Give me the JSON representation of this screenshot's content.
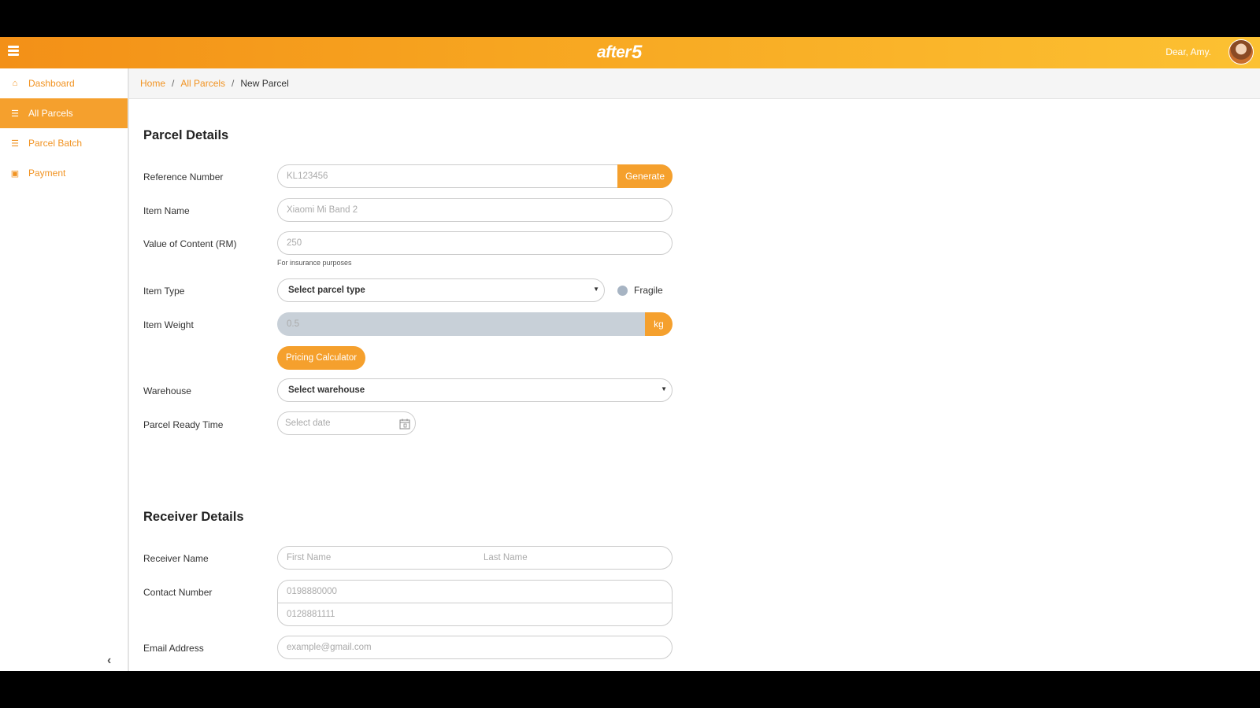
{
  "header": {
    "logo_text": "after",
    "logo_number": "5",
    "greeting": "Dear, Amy."
  },
  "sidebar": {
    "items": [
      {
        "label": "Dashboard",
        "icon": "home-icon"
      },
      {
        "label": "All Parcels",
        "icon": "list-icon",
        "active": true
      },
      {
        "label": "Parcel Batch",
        "icon": "list-icon"
      },
      {
        "label": "Payment",
        "icon": "card-icon"
      }
    ]
  },
  "breadcrumb": {
    "home": "Home",
    "all_parcels": "All Parcels",
    "current": "New Parcel"
  },
  "parcel_details": {
    "title": "Parcel Details",
    "reference_label": "Reference Number",
    "reference_placeholder": "KL123456",
    "generate_button": "Generate",
    "item_name_label": "Item Name",
    "item_name_placeholder": "Xiaomi Mi Band 2",
    "value_label": "Value of Content (RM)",
    "value_placeholder": "250",
    "value_hint": "For insurance purposes",
    "item_type_label": "Item Type",
    "item_type_select": "Select parcel type",
    "fragile_label": "Fragile",
    "weight_label": "Item Weight",
    "weight_placeholder": "0.5",
    "weight_unit": "kg",
    "pricing_button": "Pricing Calculator",
    "warehouse_label": "Warehouse",
    "warehouse_select": "Select warehouse",
    "ready_time_label": "Parcel Ready Time",
    "ready_time_placeholder": "Select date"
  },
  "receiver_details": {
    "title": "Receiver Details",
    "name_label": "Receiver Name",
    "first_name_placeholder": "First Name",
    "last_name_placeholder": "Last Name",
    "contact_label": "Contact Number",
    "contact_placeholder_1": "0198880000",
    "contact_placeholder_2": "0128881111",
    "email_label": "Email Address",
    "email_placeholder": "example@gmail.com"
  },
  "colors": {
    "accent": "#f5a02d",
    "header_start": "#f39017",
    "header_end": "#fcc132",
    "fragile_radio": "#a7b4c3",
    "weight_disabled": "#c8d0d8"
  }
}
